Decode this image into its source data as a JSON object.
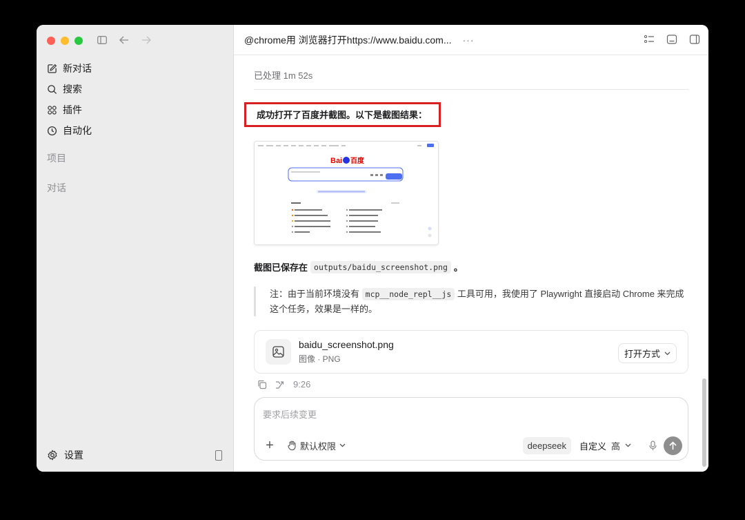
{
  "sidebar": {
    "items": [
      {
        "label": "新对话",
        "icon": "edit-icon"
      },
      {
        "label": "搜索",
        "icon": "search-icon"
      },
      {
        "label": "插件",
        "icon": "plugins-icon"
      },
      {
        "label": "自动化",
        "icon": "clock-icon"
      }
    ],
    "section_projects": "项目",
    "section_conversations": "对话",
    "settings_label": "设置"
  },
  "header": {
    "title": "@chrome用 浏览器打开https://www.baidu.com...",
    "more": "···"
  },
  "message": {
    "processed": "已处理 1m 52s",
    "headline": "成功打开了百度并截图。以下是截图结果：",
    "saved_prefix": "截图已保存在",
    "saved_path": "outputs/baidu_screenshot.png",
    "saved_suffix": "。",
    "note_part1": "注：由于当前环境没有",
    "note_code": "mcp__node_repl__js",
    "note_part2": "工具可用，我使用了 Playwright 直接启动 Chrome 来完成这个任务，效果是一样的。",
    "time": "9:26"
  },
  "file_card": {
    "name": "baidu_screenshot.png",
    "type": "图像 · PNG",
    "open_label": "打开方式"
  },
  "composer": {
    "placeholder": "要求后续变更",
    "permission": "默认权限",
    "model": "deepseek",
    "mode": "自定义",
    "level": "高"
  },
  "colors": {
    "highlight_border": "#d92020",
    "sidebar_bg": "#ececec",
    "baidu_blue": "#4e6ef2",
    "baidu_red": "#e10602"
  }
}
